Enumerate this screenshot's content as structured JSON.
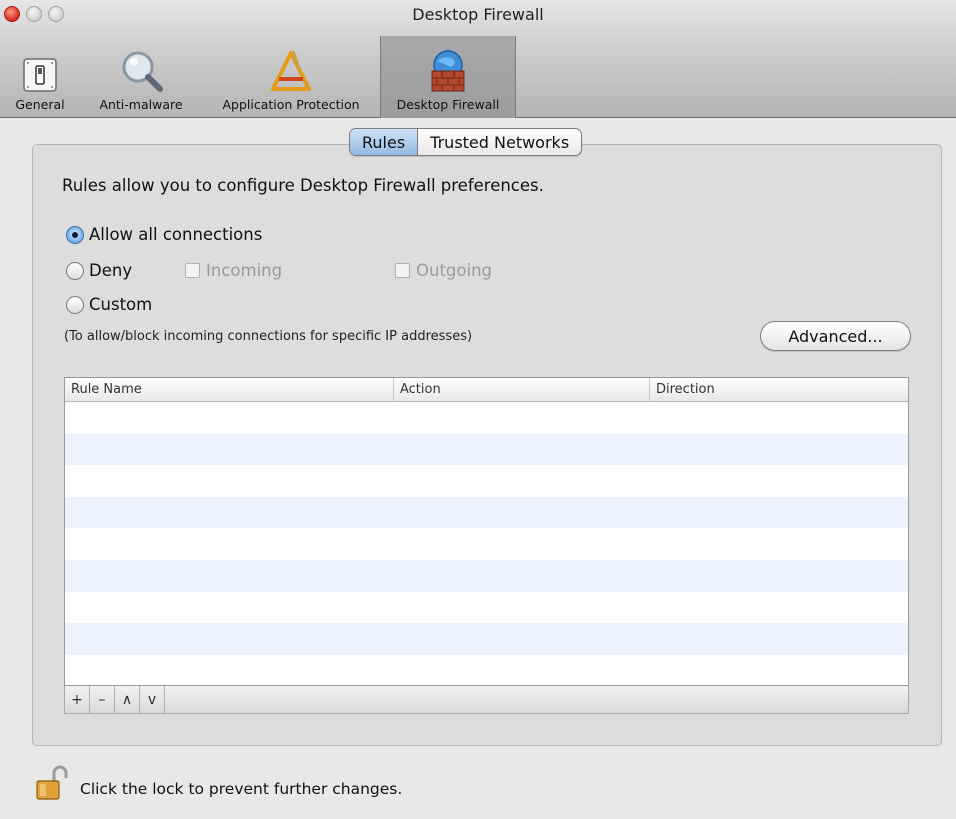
{
  "window": {
    "title": "Desktop Firewall"
  },
  "toolbar": {
    "items": [
      {
        "label": "General",
        "icon": "switch-icon"
      },
      {
        "label": "Anti-malware",
        "icon": "magnifier-icon"
      },
      {
        "label": "Application Protection",
        "icon": "app-triangle-icon"
      },
      {
        "label": "Desktop Firewall",
        "icon": "firewall-globe-icon",
        "selected": true
      }
    ]
  },
  "tabs": {
    "rules": "Rules",
    "trusted": "Trusted Networks",
    "active": "Rules"
  },
  "panel": {
    "description": "Rules allow you to configure Desktop Firewall preferences.",
    "options": {
      "allow": "Allow all connections",
      "deny": "Deny",
      "incoming": "Incoming",
      "outgoing": "Outgoing",
      "custom": "Custom",
      "selected": "Allow all connections"
    },
    "hint": "(To allow/block incoming connections for specific IP addresses)",
    "advanced_button": "Advanced..."
  },
  "table": {
    "columns": [
      "Rule Name",
      "Action",
      "Direction"
    ],
    "rows": []
  },
  "table_buttons": {
    "add": "+",
    "remove": "–",
    "up": "∧",
    "down": "v"
  },
  "lock": {
    "text": "Click the lock to prevent further changes.",
    "icon": "open-lock-icon"
  },
  "colors": {
    "tab_active": "#8fb6e2",
    "row_alt": "#edf3fe",
    "close": "#d8261b"
  }
}
